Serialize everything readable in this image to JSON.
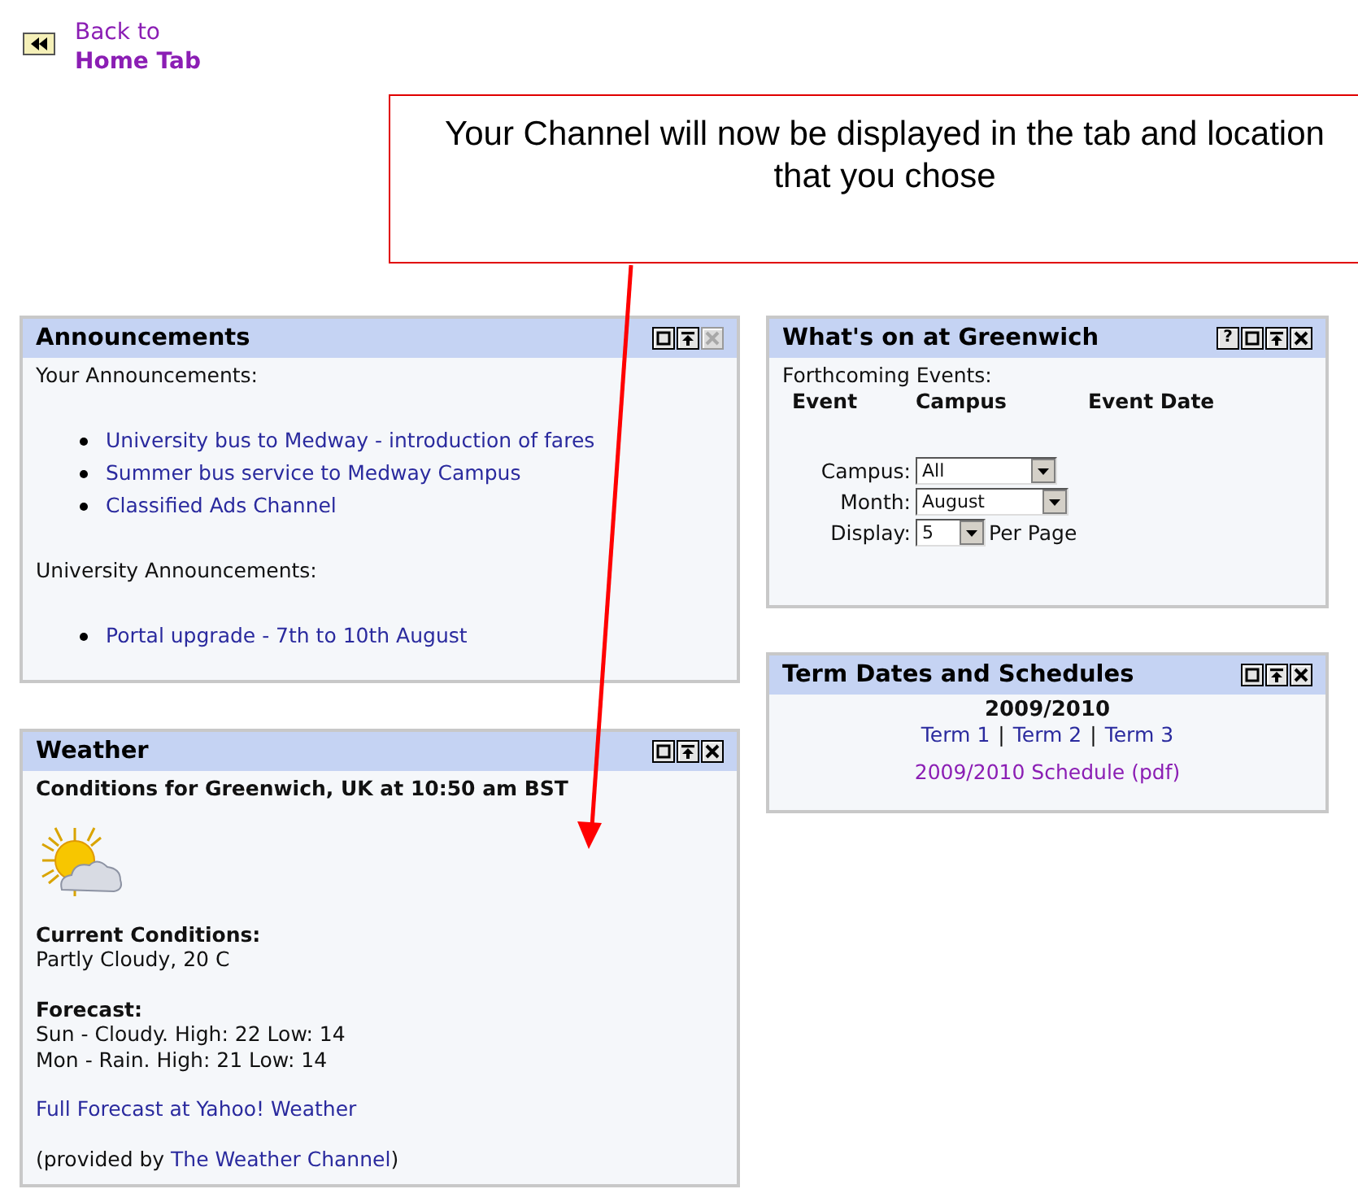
{
  "back_link": {
    "line_1": "Back to",
    "line_2": "Home Tab"
  },
  "callout": {
    "text": "Your Channel will now be displayed in the tab and location that you chose"
  },
  "columns": [
    {
      "channels": [
        {
          "kind": "announcements",
          "title": "Announcements",
          "controls": [
            {
              "kind": "minimize",
              "disabled": false
            },
            {
              "kind": "top",
              "disabled": false
            },
            {
              "kind": "close",
              "disabled": true
            }
          ],
          "sections": [
            {
              "heading": "Your Announcements:",
              "items": [
                "University bus to Medway - introduction of fares",
                "Summer bus service to Medway Campus",
                "Classified Ads Channel"
              ]
            },
            {
              "heading": "University Announcements:",
              "items": [
                "Portal upgrade - 7th to 10th August"
              ]
            }
          ]
        },
        {
          "kind": "weather",
          "title": "Weather",
          "controls": [
            {
              "kind": "minimize",
              "disabled": false
            },
            {
              "kind": "top",
              "disabled": false
            },
            {
              "kind": "close",
              "disabled": false
            }
          ],
          "heading": "Conditions for Greenwich, UK at 10:50 am BST",
          "current_label": "Current Conditions:",
          "current_value": "Partly Cloudy, 20 C",
          "forecast_label": "Forecast:",
          "forecast": [
            "Sun - Cloudy. High: 22 Low: 14",
            "Mon - Rain. High: 21 Low: 14"
          ],
          "link": "Full Forecast at Yahoo! Weather",
          "credit_prefix": "(provided by ",
          "credit_link": "The Weather Channel",
          "credit_suffix": ")"
        }
      ]
    },
    {
      "channels": [
        {
          "kind": "events",
          "title": "What's on at Greenwich",
          "controls": [
            {
              "kind": "help",
              "glyph": "?",
              "disabled": false
            },
            {
              "kind": "minimize",
              "disabled": false
            },
            {
              "kind": "top",
              "disabled": false
            },
            {
              "kind": "close",
              "disabled": false
            }
          ],
          "intro": "Forthcoming Events:",
          "table_columns": [
            "Event",
            "Campus",
            "Event Date"
          ],
          "filters": [
            {
              "label": "Campus:",
              "value": "All"
            },
            {
              "label": "Month:",
              "value": "August"
            },
            {
              "label": "Display:",
              "value": "5",
              "suffix": "Per Page"
            }
          ]
        },
        {
          "kind": "terms",
          "title": "Term Dates and Schedules",
          "controls": [
            {
              "kind": "minimize",
              "disabled": false
            },
            {
              "kind": "top",
              "disabled": false
            },
            {
              "kind": "close",
              "disabled": false
            }
          ],
          "year": "2009/2010",
          "terms": [
            "Term 1",
            "Term 2",
            "Term 3"
          ],
          "separator": "|",
          "schedule": "2009/2010 Schedule (pdf)"
        }
      ]
    }
  ]
}
